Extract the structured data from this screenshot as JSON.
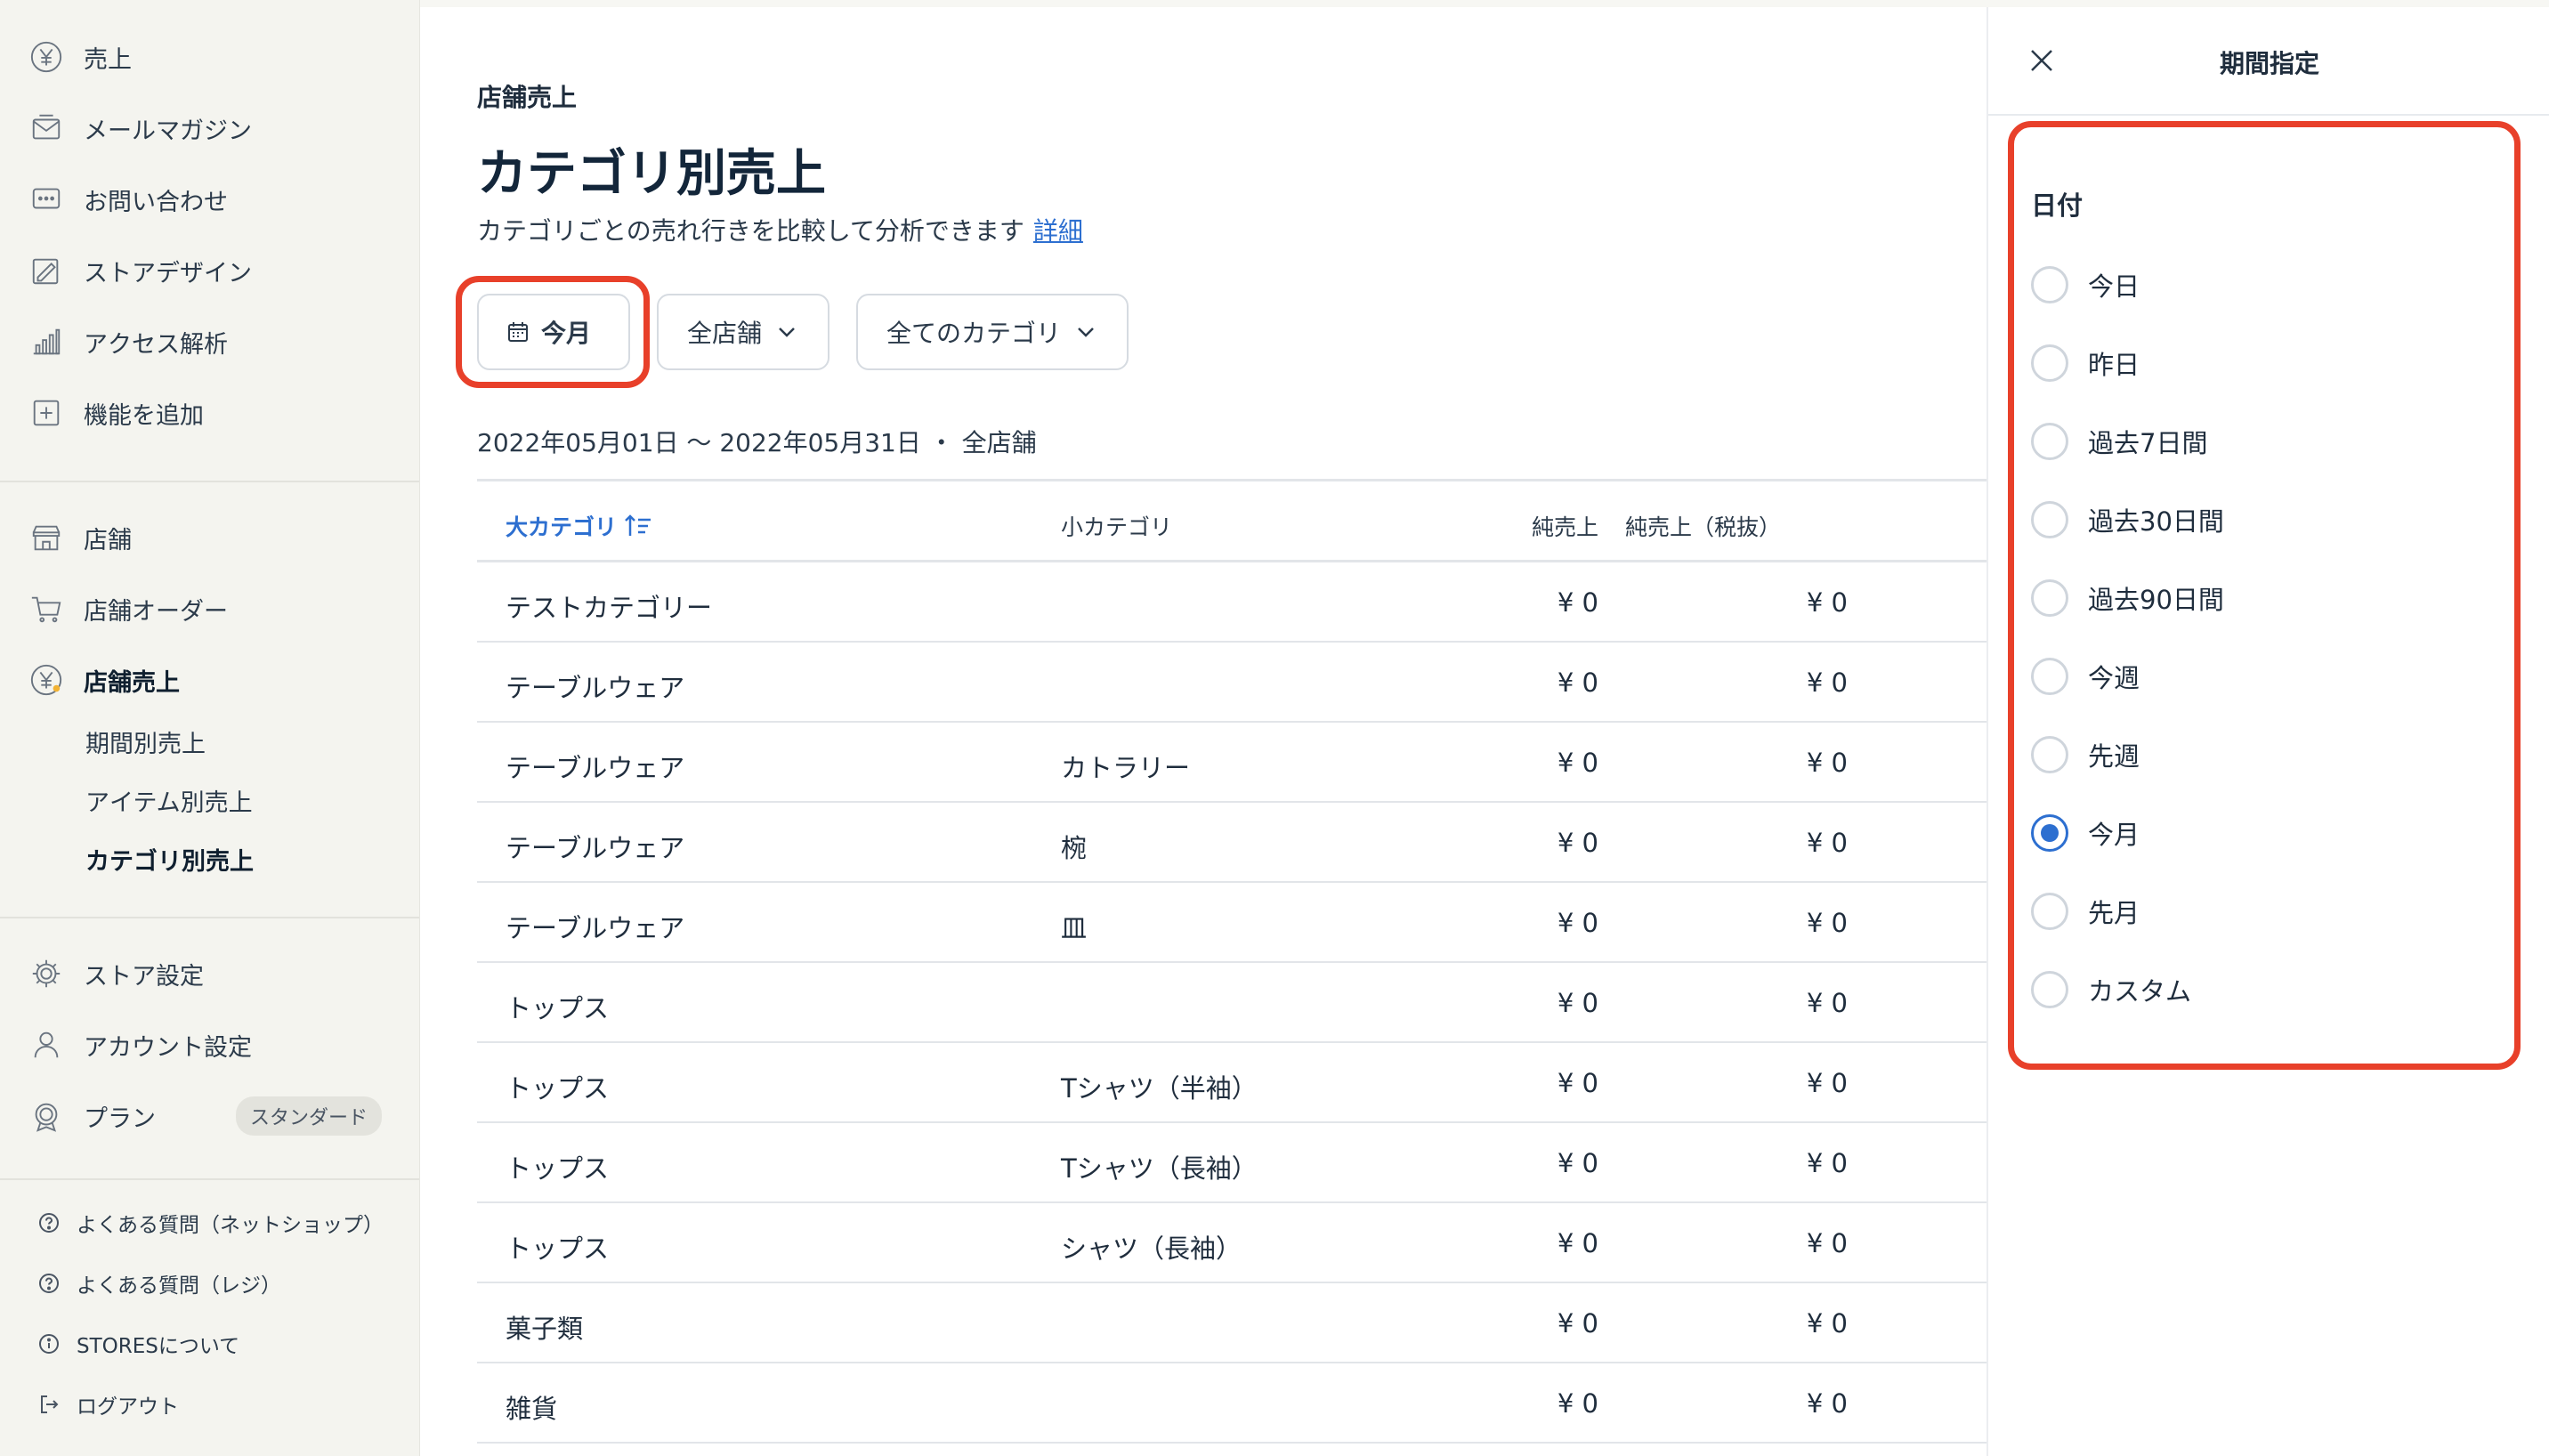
{
  "sidebar": {
    "items_top": [
      {
        "label": "売上",
        "icon": "yen-icon"
      },
      {
        "label": "メールマガジン",
        "icon": "mail-icon"
      },
      {
        "label": "お問い合わせ",
        "icon": "chat-icon"
      },
      {
        "label": "ストアデザイン",
        "icon": "design-icon"
      },
      {
        "label": "アクセス解析",
        "icon": "bar-chart-icon"
      },
      {
        "label": "機能を追加",
        "icon": "plus-box-icon"
      }
    ],
    "items_store": [
      {
        "label": "店舗",
        "icon": "store-icon"
      },
      {
        "label": "店舗オーダー",
        "icon": "cart-icon"
      },
      {
        "label": "店舗売上",
        "icon": "yen-icon"
      }
    ],
    "sub_items": [
      {
        "label": "期間別売上"
      },
      {
        "label": "アイテム別売上"
      },
      {
        "label": "カテゴリ別売上"
      }
    ],
    "items_settings": [
      {
        "label": "ストア設定",
        "icon": "gear-icon"
      },
      {
        "label": "アカウント設定",
        "icon": "user-icon"
      },
      {
        "label": "プラン",
        "icon": "badge-icon"
      }
    ],
    "plan_badge": "スタンダード",
    "help_items": [
      {
        "label": "よくある質問（ネットショップ）",
        "icon": "question-icon"
      },
      {
        "label": "よくある質問（レジ）",
        "icon": "question-icon"
      },
      {
        "label": "STORESについて",
        "icon": "info-icon"
      },
      {
        "label": "ログアウト",
        "icon": "logout-icon"
      }
    ]
  },
  "main": {
    "breadcrumb": "店舗売上",
    "title": "カテゴリ別売上",
    "description": "カテゴリごとの売れ行きを比較して分析できます",
    "detail_link": "詳細",
    "filters": {
      "date": "今月",
      "store": "全店舗",
      "category": "全てのカテゴリ"
    },
    "range_text": "2022年05月01日 〜 2022年05月31日 ・ 全店舗",
    "table": {
      "headers": {
        "major": "大カテゴリ",
        "minor": "小カテゴリ",
        "net": "純売上",
        "net_ex": "純売上（税抜）"
      },
      "rows": [
        {
          "major": "テストカテゴリー",
          "minor": "",
          "net": "¥ 0",
          "net_ex": "¥ 0"
        },
        {
          "major": "テーブルウェア",
          "minor": "",
          "net": "¥ 0",
          "net_ex": "¥ 0"
        },
        {
          "major": "テーブルウェア",
          "minor": "カトラリー",
          "net": "¥ 0",
          "net_ex": "¥ 0"
        },
        {
          "major": "テーブルウェア",
          "minor": "椀",
          "net": "¥ 0",
          "net_ex": "¥ 0"
        },
        {
          "major": "テーブルウェア",
          "minor": "皿",
          "net": "¥ 0",
          "net_ex": "¥ 0"
        },
        {
          "major": "トップス",
          "minor": "",
          "net": "¥ 0",
          "net_ex": "¥ 0"
        },
        {
          "major": "トップス",
          "minor": "Tシャツ（半袖）",
          "net": "¥ 0",
          "net_ex": "¥ 0"
        },
        {
          "major": "トップス",
          "minor": "Tシャツ（長袖）",
          "net": "¥ 0",
          "net_ex": "¥ 0"
        },
        {
          "major": "トップス",
          "minor": "シャツ（長袖）",
          "net": "¥ 0",
          "net_ex": "¥ 0"
        },
        {
          "major": "菓子類",
          "minor": "",
          "net": "¥ 0",
          "net_ex": "¥ 0"
        },
        {
          "major": "雑貨",
          "minor": "",
          "net": "¥ 0",
          "net_ex": "¥ 0"
        }
      ]
    }
  },
  "panel": {
    "title": "期間指定",
    "group_label": "日付",
    "options": [
      {
        "label": "今日",
        "checked": false
      },
      {
        "label": "昨日",
        "checked": false
      },
      {
        "label": "過去7日間",
        "checked": false
      },
      {
        "label": "過去30日間",
        "checked": false
      },
      {
        "label": "過去90日間",
        "checked": false
      },
      {
        "label": "今週",
        "checked": false
      },
      {
        "label": "先週",
        "checked": false
      },
      {
        "label": "今月",
        "checked": true
      },
      {
        "label": "先月",
        "checked": false
      },
      {
        "label": "カスタム",
        "checked": false
      }
    ]
  },
  "colors": {
    "accent": "#2d6fd0",
    "highlight": "#e8402a"
  }
}
